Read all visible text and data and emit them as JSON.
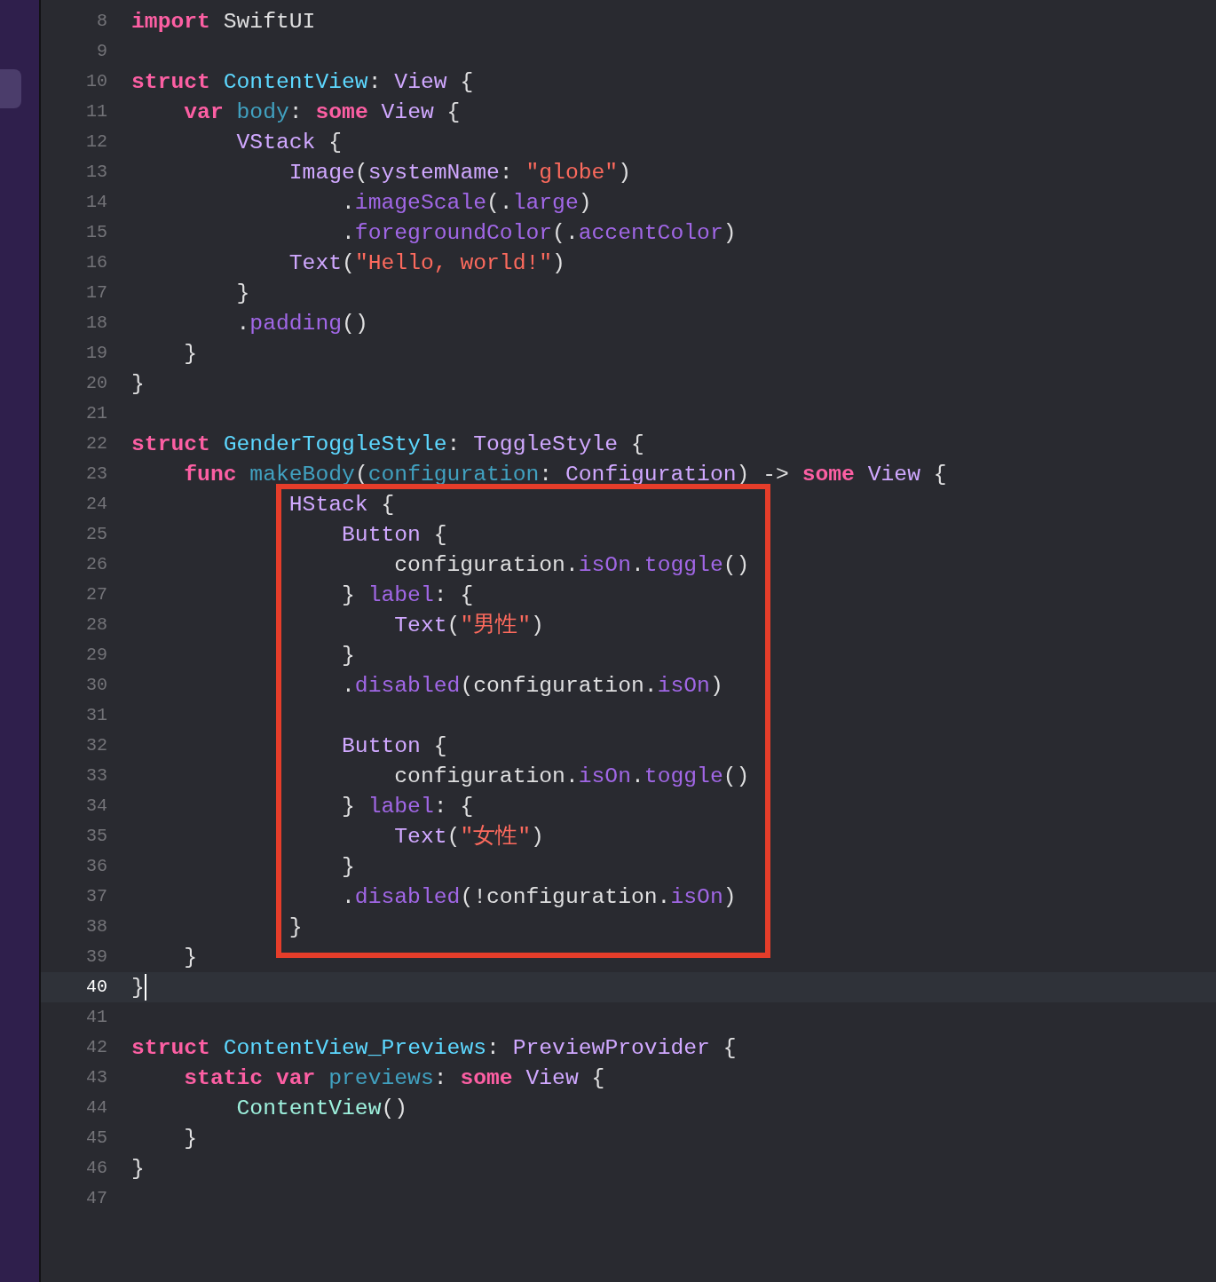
{
  "sidebar": {
    "tab": {
      "selected": true
    }
  },
  "editor": {
    "lines": [
      {
        "kind": "line",
        "number": "8",
        "tokens": [
          {
            "kind": "keyword",
            "text": "import"
          },
          {
            "kind": "plain",
            "text": " SwiftUI"
          }
        ]
      },
      {
        "kind": "line",
        "number": "9"
      },
      {
        "kind": "line",
        "number": "10",
        "tokens": [
          {
            "kind": "keyword",
            "text": "struct "
          },
          {
            "kind": "decl_type",
            "text": "ContentView"
          },
          {
            "kind": "plain",
            "text": ": "
          },
          {
            "kind": "type",
            "text": "View"
          },
          {
            "kind": "plain",
            "text": " {"
          }
        ]
      },
      {
        "kind": "line",
        "number": "11",
        "tokens": [
          {
            "kind": "keyword",
            "text": "    var "
          },
          {
            "kind": "decl",
            "text": "body"
          },
          {
            "kind": "plain",
            "text": ": "
          },
          {
            "kind": "keyword",
            "text": "some "
          },
          {
            "kind": "type",
            "text": "View"
          },
          {
            "kind": "plain",
            "text": " {"
          }
        ]
      },
      {
        "kind": "line",
        "number": "12",
        "tokens": [
          {
            "kind": "type",
            "text": "        VStack"
          },
          {
            "kind": "plain",
            "text": " {"
          }
        ]
      },
      {
        "kind": "line",
        "number": "13",
        "tokens": [
          {
            "kind": "type",
            "text": "            Image"
          },
          {
            "kind": "plain",
            "text": "("
          },
          {
            "kind": "type",
            "text": "systemName"
          },
          {
            "kind": "plain",
            "text": ": "
          },
          {
            "kind": "string",
            "text": "\"globe\""
          },
          {
            "kind": "plain",
            "text": ")"
          }
        ]
      },
      {
        "kind": "line",
        "number": "14",
        "tokens": [
          {
            "kind": "plain",
            "text": "                ."
          },
          {
            "kind": "member",
            "text": "imageScale"
          },
          {
            "kind": "plain",
            "text": "(."
          },
          {
            "kind": "member",
            "text": "large"
          },
          {
            "kind": "plain",
            "text": ")"
          }
        ]
      },
      {
        "kind": "line",
        "number": "15",
        "tokens": [
          {
            "kind": "plain",
            "text": "                ."
          },
          {
            "kind": "member",
            "text": "foregroundColor"
          },
          {
            "kind": "plain",
            "text": "(."
          },
          {
            "kind": "member",
            "text": "accentColor"
          },
          {
            "kind": "plain",
            "text": ")"
          }
        ]
      },
      {
        "kind": "line",
        "number": "16",
        "tokens": [
          {
            "kind": "type",
            "text": "            Text"
          },
          {
            "kind": "plain",
            "text": "("
          },
          {
            "kind": "string",
            "text": "\"Hello, world!\""
          },
          {
            "kind": "plain",
            "text": ")"
          }
        ]
      },
      {
        "kind": "line",
        "number": "17",
        "tokens": [
          {
            "kind": "plain",
            "text": "        }"
          }
        ]
      },
      {
        "kind": "line",
        "number": "18",
        "tokens": [
          {
            "kind": "plain",
            "text": "        ."
          },
          {
            "kind": "member",
            "text": "padding"
          },
          {
            "kind": "plain",
            "text": "()"
          }
        ]
      },
      {
        "kind": "line",
        "number": "19",
        "tokens": [
          {
            "kind": "plain",
            "text": "    }"
          }
        ]
      },
      {
        "kind": "line",
        "number": "20",
        "tokens": [
          {
            "kind": "plain",
            "text": "}"
          }
        ]
      },
      {
        "kind": "line",
        "number": "21"
      },
      {
        "kind": "line",
        "number": "22",
        "tokens": [
          {
            "kind": "keyword",
            "text": "struct "
          },
          {
            "kind": "decl_type",
            "text": "GenderToggleStyle"
          },
          {
            "kind": "plain",
            "text": ": "
          },
          {
            "kind": "type",
            "text": "ToggleStyle"
          },
          {
            "kind": "plain",
            "text": " {"
          }
        ]
      },
      {
        "kind": "line",
        "number": "23",
        "tokens": [
          {
            "kind": "keyword",
            "text": "    func "
          },
          {
            "kind": "decl",
            "text": "makeBody"
          },
          {
            "kind": "plain",
            "text": "("
          },
          {
            "kind": "decl",
            "text": "configuration"
          },
          {
            "kind": "plain",
            "text": ": "
          },
          {
            "kind": "type",
            "text": "Configuration"
          },
          {
            "kind": "plain",
            "text": ") -> "
          },
          {
            "kind": "keyword",
            "text": "some "
          },
          {
            "kind": "type",
            "text": "View"
          },
          {
            "kind": "plain",
            "text": " {"
          }
        ]
      },
      {
        "kind": "highlight_box",
        "lines": [
          {
            "kind": "line",
            "number": "24",
            "tokens": [
              {
                "kind": "type",
                "text": "            HStack"
              },
              {
                "kind": "plain",
                "text": " {"
              }
            ]
          },
          {
            "kind": "line",
            "number": "25",
            "tokens": [
              {
                "kind": "type",
                "text": "                Button"
              },
              {
                "kind": "plain",
                "text": " {"
              }
            ]
          },
          {
            "kind": "line",
            "number": "26",
            "tokens": [
              {
                "kind": "plain",
                "text": "                    configuration."
              },
              {
                "kind": "member",
                "text": "isOn"
              },
              {
                "kind": "plain",
                "text": "."
              },
              {
                "kind": "member",
                "text": "toggle"
              },
              {
                "kind": "plain",
                "text": "()"
              }
            ]
          },
          {
            "kind": "line",
            "number": "27",
            "tokens": [
              {
                "kind": "plain",
                "text": "                } "
              },
              {
                "kind": "member",
                "text": "label"
              },
              {
                "kind": "plain",
                "text": ": {"
              }
            ]
          },
          {
            "kind": "line",
            "number": "28",
            "tokens": [
              {
                "kind": "type",
                "text": "                    Text"
              },
              {
                "kind": "plain",
                "text": "("
              },
              {
                "kind": "string",
                "text": "\"男性\""
              },
              {
                "kind": "plain",
                "text": ")"
              }
            ]
          },
          {
            "kind": "line",
            "number": "29",
            "tokens": [
              {
                "kind": "plain",
                "text": "                }"
              }
            ]
          },
          {
            "kind": "line",
            "number": "30",
            "tokens": [
              {
                "kind": "plain",
                "text": "                ."
              },
              {
                "kind": "member",
                "text": "disabled"
              },
              {
                "kind": "plain",
                "text": "(configuration."
              },
              {
                "kind": "member",
                "text": "isOn"
              },
              {
                "kind": "plain",
                "text": ")"
              }
            ]
          },
          {
            "kind": "line",
            "number": "31"
          },
          {
            "kind": "line",
            "number": "32",
            "tokens": [
              {
                "kind": "type",
                "text": "                Button"
              },
              {
                "kind": "plain",
                "text": " {"
              }
            ]
          },
          {
            "kind": "line",
            "number": "33",
            "tokens": [
              {
                "kind": "plain",
                "text": "                    configuration."
              },
              {
                "kind": "member",
                "text": "isOn"
              },
              {
                "kind": "plain",
                "text": "."
              },
              {
                "kind": "member",
                "text": "toggle"
              },
              {
                "kind": "plain",
                "text": "()"
              }
            ]
          },
          {
            "kind": "line",
            "number": "34",
            "tokens": [
              {
                "kind": "plain",
                "text": "                } "
              },
              {
                "kind": "member",
                "text": "label"
              },
              {
                "kind": "plain",
                "text": ": {"
              }
            ]
          },
          {
            "kind": "line",
            "number": "35",
            "tokens": [
              {
                "kind": "type",
                "text": "                    Text"
              },
              {
                "kind": "plain",
                "text": "("
              },
              {
                "kind": "string",
                "text": "\"女性\""
              },
              {
                "kind": "plain",
                "text": ")"
              }
            ]
          },
          {
            "kind": "line",
            "number": "36",
            "tokens": [
              {
                "kind": "plain",
                "text": "                }"
              }
            ]
          },
          {
            "kind": "line",
            "number": "37",
            "tokens": [
              {
                "kind": "plain",
                "text": "                ."
              },
              {
                "kind": "member",
                "text": "disabled"
              },
              {
                "kind": "plain",
                "text": "(!configuration."
              },
              {
                "kind": "member",
                "text": "isOn"
              },
              {
                "kind": "plain",
                "text": ")"
              }
            ]
          },
          {
            "kind": "line",
            "number": "38",
            "tokens": [
              {
                "kind": "plain",
                "text": "            }"
              }
            ]
          }
        ]
      },
      {
        "kind": "line",
        "number": "39",
        "tokens": [
          {
            "kind": "plain",
            "text": "    }"
          }
        ]
      },
      {
        "kind": "line",
        "number": "40",
        "current": true,
        "tokens": [
          {
            "kind": "plain",
            "text": "}"
          }
        ]
      },
      {
        "kind": "line",
        "number": "41"
      },
      {
        "kind": "line",
        "number": "42",
        "tokens": [
          {
            "kind": "keyword",
            "text": "struct "
          },
          {
            "kind": "decl_type",
            "text": "ContentView_Previews"
          },
          {
            "kind": "plain",
            "text": ": "
          },
          {
            "kind": "type",
            "text": "PreviewProvider"
          },
          {
            "kind": "plain",
            "text": " {"
          }
        ]
      },
      {
        "kind": "line",
        "number": "43",
        "tokens": [
          {
            "kind": "keyword",
            "text": "    static var "
          },
          {
            "kind": "decl",
            "text": "previews"
          },
          {
            "kind": "plain",
            "text": ": "
          },
          {
            "kind": "keyword",
            "text": "some "
          },
          {
            "kind": "type",
            "text": "View"
          },
          {
            "kind": "plain",
            "text": " {"
          }
        ]
      },
      {
        "kind": "line",
        "number": "44",
        "tokens": [
          {
            "kind": "project_type",
            "text": "        ContentView"
          },
          {
            "kind": "plain",
            "text": "()"
          }
        ]
      },
      {
        "kind": "line",
        "number": "45",
        "tokens": [
          {
            "kind": "plain",
            "text": "    }"
          }
        ]
      },
      {
        "kind": "line",
        "number": "46",
        "tokens": [
          {
            "kind": "plain",
            "text": "}"
          }
        ]
      },
      {
        "kind": "line",
        "number": "47"
      }
    ]
  }
}
